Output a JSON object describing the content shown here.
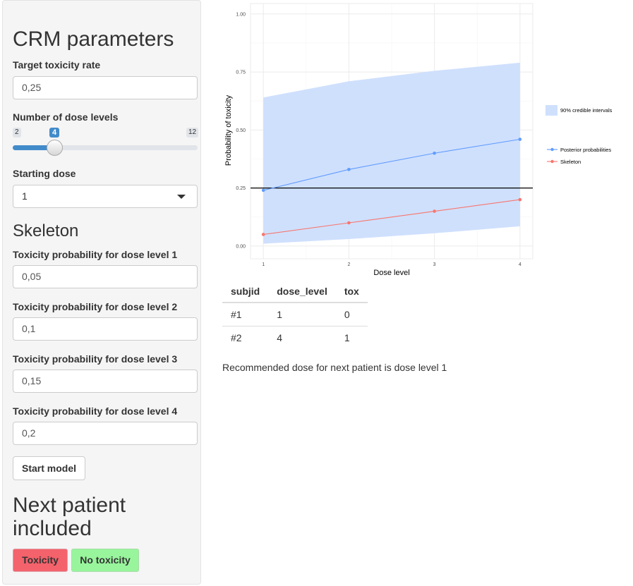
{
  "sidebar": {
    "title": "CRM parameters",
    "target_label": "Target toxicity rate",
    "target_value": "0,25",
    "dose_levels_label": "Number of dose levels",
    "slider": {
      "min": 2,
      "max": 12,
      "value": 4,
      "min_text": "2",
      "max_text": "12",
      "value_text": "4"
    },
    "starting_dose_label": "Starting dose",
    "starting_dose_value": "1",
    "skeleton_title": "Skeleton",
    "skeleton_fields": [
      {
        "label": "Toxicity probability for dose level 1",
        "value": "0,05"
      },
      {
        "label": "Toxicity probability for dose level 2",
        "value": "0,1"
      },
      {
        "label": "Toxicity probability for dose level 3",
        "value": "0,15"
      },
      {
        "label": "Toxicity probability for dose level 4",
        "value": "0,2"
      }
    ],
    "start_button": "Start model",
    "next_patient_title_line1": "Next patient",
    "next_patient_title_line2": "included",
    "toxicity_button": "Toxicity",
    "no_toxicity_button": "No toxicity"
  },
  "chart_data": {
    "type": "line",
    "xlabel": "Dose level",
    "ylabel": "Probability of toxicity",
    "x": [
      1,
      2,
      3,
      4
    ],
    "x_tick_labels": [
      "1",
      "2",
      "3",
      "4"
    ],
    "ylim": [
      0,
      1
    ],
    "y_ticks": [
      0,
      0.25,
      0.5,
      0.75,
      1
    ],
    "y_tick_labels": [
      "0.00",
      "0.25",
      "0.50",
      "0.75",
      "1.00"
    ],
    "hline": 0.25,
    "grid": true,
    "legend_position": "right",
    "series": [
      {
        "name": "Posterior probabilities",
        "values": [
          0.24,
          0.33,
          0.4,
          0.46
        ],
        "color": "#619cff"
      },
      {
        "name": "Skeleton",
        "values": [
          0.05,
          0.1,
          0.15,
          0.2
        ],
        "color": "#f8766d"
      }
    ],
    "band": {
      "name": "90% credible intervals",
      "lower": [
        0.01,
        0.03,
        0.055,
        0.085
      ],
      "upper": [
        0.64,
        0.71,
        0.755,
        0.79
      ],
      "color": "#cfe0fd"
    }
  },
  "table": {
    "columns": [
      "subjid",
      "dose_level",
      "tox"
    ],
    "rows": [
      [
        "#1",
        "1",
        "0"
      ],
      [
        "#2",
        "4",
        "1"
      ]
    ]
  },
  "recommendation": "Recommended dose for next patient is dose level 1"
}
